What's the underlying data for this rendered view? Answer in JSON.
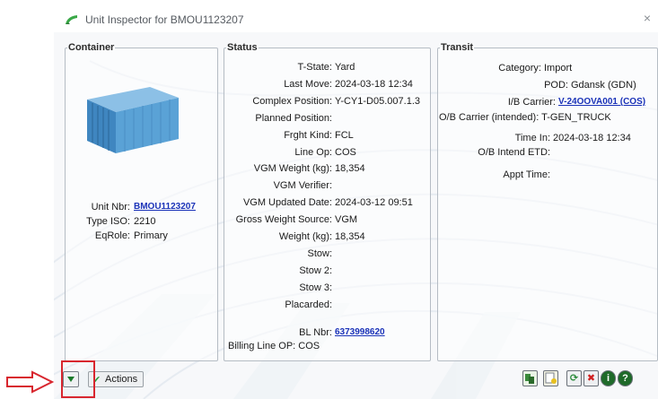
{
  "window": {
    "title": "Unit Inspector for BMOU1123207",
    "close_glyph": "×"
  },
  "container_panel": {
    "legend": "Container",
    "unit_nbr_label": "Unit Nbr:",
    "unit_nbr_value": "BMOU1123207",
    "type_iso_label": "Type ISO:",
    "type_iso_value": "2210",
    "eq_role_label": "EqRole:",
    "eq_role_value": "Primary",
    "container_color": "#4a90c8"
  },
  "status_panel": {
    "legend": "Status",
    "rows": [
      {
        "label": "T-State:",
        "value": "Yard"
      },
      {
        "label": "Last Move:",
        "value": "2024-03-18 12:34"
      },
      {
        "label": "Complex Position:",
        "value": "Y-CY1-D05.007.1.3"
      },
      {
        "label": "Planned Position:",
        "value": ""
      },
      {
        "label": "Frght Kind:",
        "value": "FCL"
      },
      {
        "label": "Line Op:",
        "value": "COS"
      },
      {
        "label": "VGM Weight (kg):",
        "value": "18,354"
      },
      {
        "label": "VGM Verifier:",
        "value": ""
      },
      {
        "label": "VGM Updated Date:",
        "value": "2024-03-12 09:51"
      },
      {
        "label": "Gross Weight Source:",
        "value": "VGM"
      },
      {
        "label": "Weight (kg):",
        "value": "18,354"
      },
      {
        "label": "Stow:",
        "value": ""
      },
      {
        "label": "Stow 2:",
        "value": ""
      },
      {
        "label": "Stow 3:",
        "value": ""
      },
      {
        "label": "Placarded:",
        "value": ""
      }
    ],
    "bl_nbr_label": "BL Nbr:",
    "bl_nbr_value": "6373998620",
    "billing_line_label": "Billing Line OP:",
    "billing_line_value": "COS"
  },
  "transit_panel": {
    "legend": "Transit",
    "category_label": "Category:",
    "category_value": "Import",
    "pod_label": "POD:",
    "pod_value": "Gdansk (GDN)",
    "ib_carrier_label": "I/B Carrier:",
    "ib_carrier_value": "V-24OOVA001 (COS)",
    "ob_carrier_label": "O/B Carrier (intended):",
    "ob_carrier_value": "T-GEN_TRUCK",
    "time_in_label": "Time In:",
    "time_in_value": "2024-03-18 12:34",
    "ob_etd_label": "O/B Intend ETD:",
    "ob_etd_value": "",
    "appt_time_label": "Appt Time:",
    "appt_time_value": ""
  },
  "toolbar": {
    "actions_label": "Actions",
    "icons": [
      "copy-icon",
      "note-icon",
      "refresh-icon",
      "close-x-icon",
      "info-icon",
      "help-icon"
    ]
  },
  "colors": {
    "highlight": "#d8262e",
    "link": "#1a32b8"
  }
}
